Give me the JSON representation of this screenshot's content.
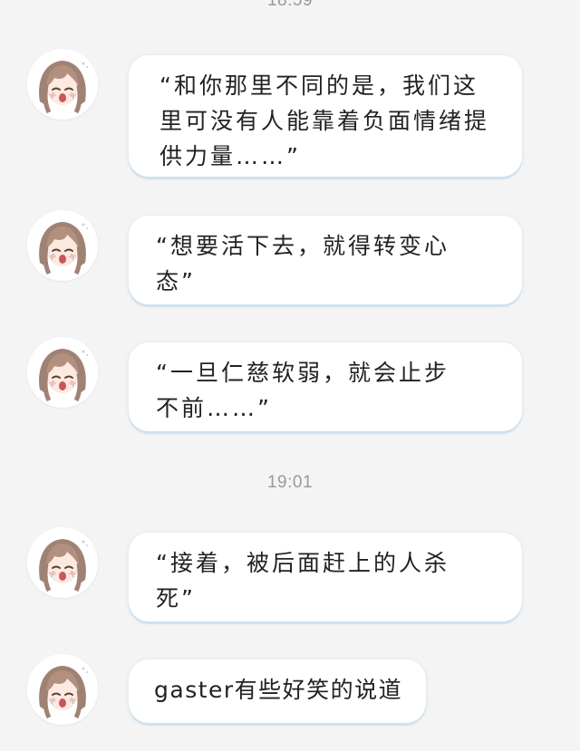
{
  "chat": {
    "timestamps": [
      "18:59",
      "19:01"
    ],
    "messages": [
      {
        "text": "“和你那里不同的是，我们这里可没有人能靠着负面情绪提供力量……”"
      },
      {
        "text": "“想要活下去，就得转变心态”"
      },
      {
        "text": "“一旦仁慈软弱，就会止步不前……”"
      },
      {
        "text": "“接着，被后面赶上的人杀死”"
      },
      {
        "text": "gaster有些好笑的说道"
      }
    ]
  },
  "avatar_icon": "anime-girl-avatar-icon",
  "colors": {
    "background": "#f4f4f4",
    "bubble": "#ffffff",
    "bubble_shadow": "#cfe2ee",
    "timestamp_text": "#9a9a9a",
    "message_text": "#222222"
  }
}
